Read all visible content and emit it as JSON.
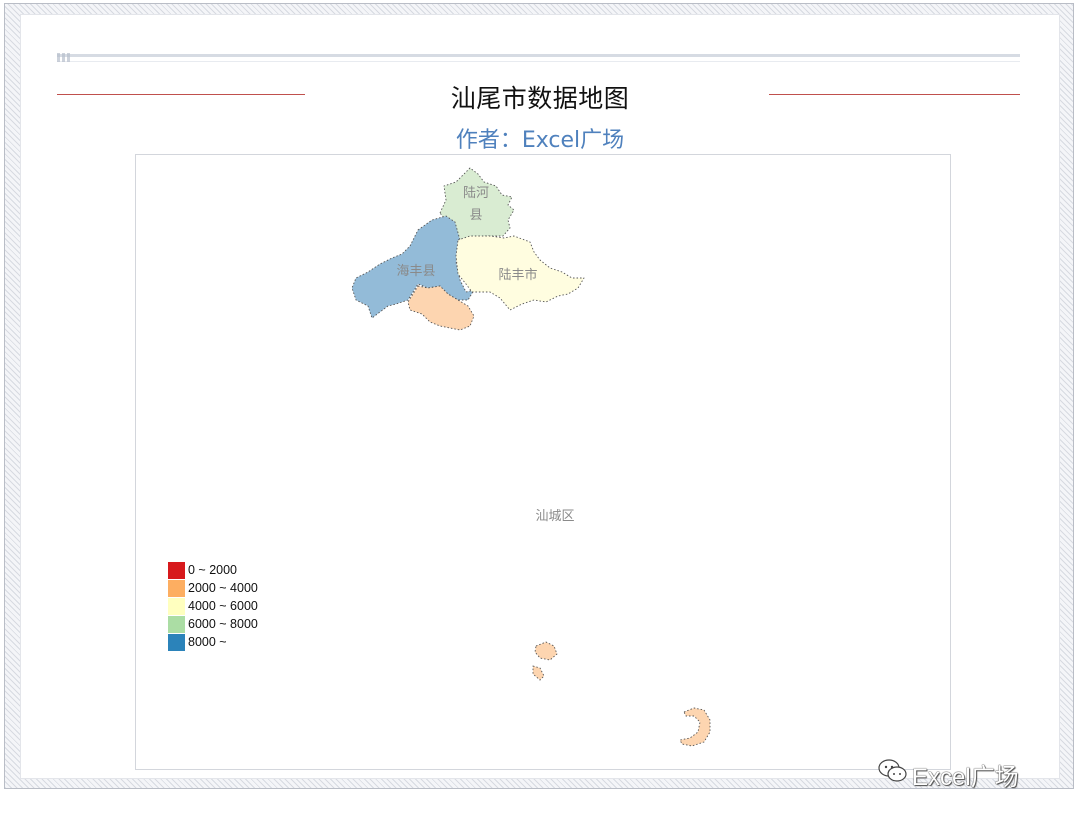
{
  "title": "汕尾市数据地图",
  "subtitle": "作者：Excel广场",
  "watermark": "Excel广场",
  "map": {
    "regions": [
      {
        "name": "陆河县",
        "label": "陆河\n县",
        "color": "#d9ecd2"
      },
      {
        "name": "海丰县",
        "label": "海丰县",
        "color": "#93bbd8"
      },
      {
        "name": "陆丰市",
        "label": "陆丰市",
        "color": "#fffde0"
      },
      {
        "name": "城区",
        "label": "",
        "color": "#fdd5b0"
      },
      {
        "name": "汕城区",
        "label": "汕城区",
        "color": "#fdd5b0"
      }
    ],
    "legend": [
      {
        "range": "0 ~ 2000",
        "color": "#d7191c"
      },
      {
        "range": "2000 ~ 4000",
        "color": "#fdae61"
      },
      {
        "range": "4000 ~ 6000",
        "color": "#ffffbf"
      },
      {
        "range": "6000 ~ 8000",
        "color": "#abdda4"
      },
      {
        "range": "8000 ~",
        "color": "#2b83ba"
      }
    ]
  }
}
